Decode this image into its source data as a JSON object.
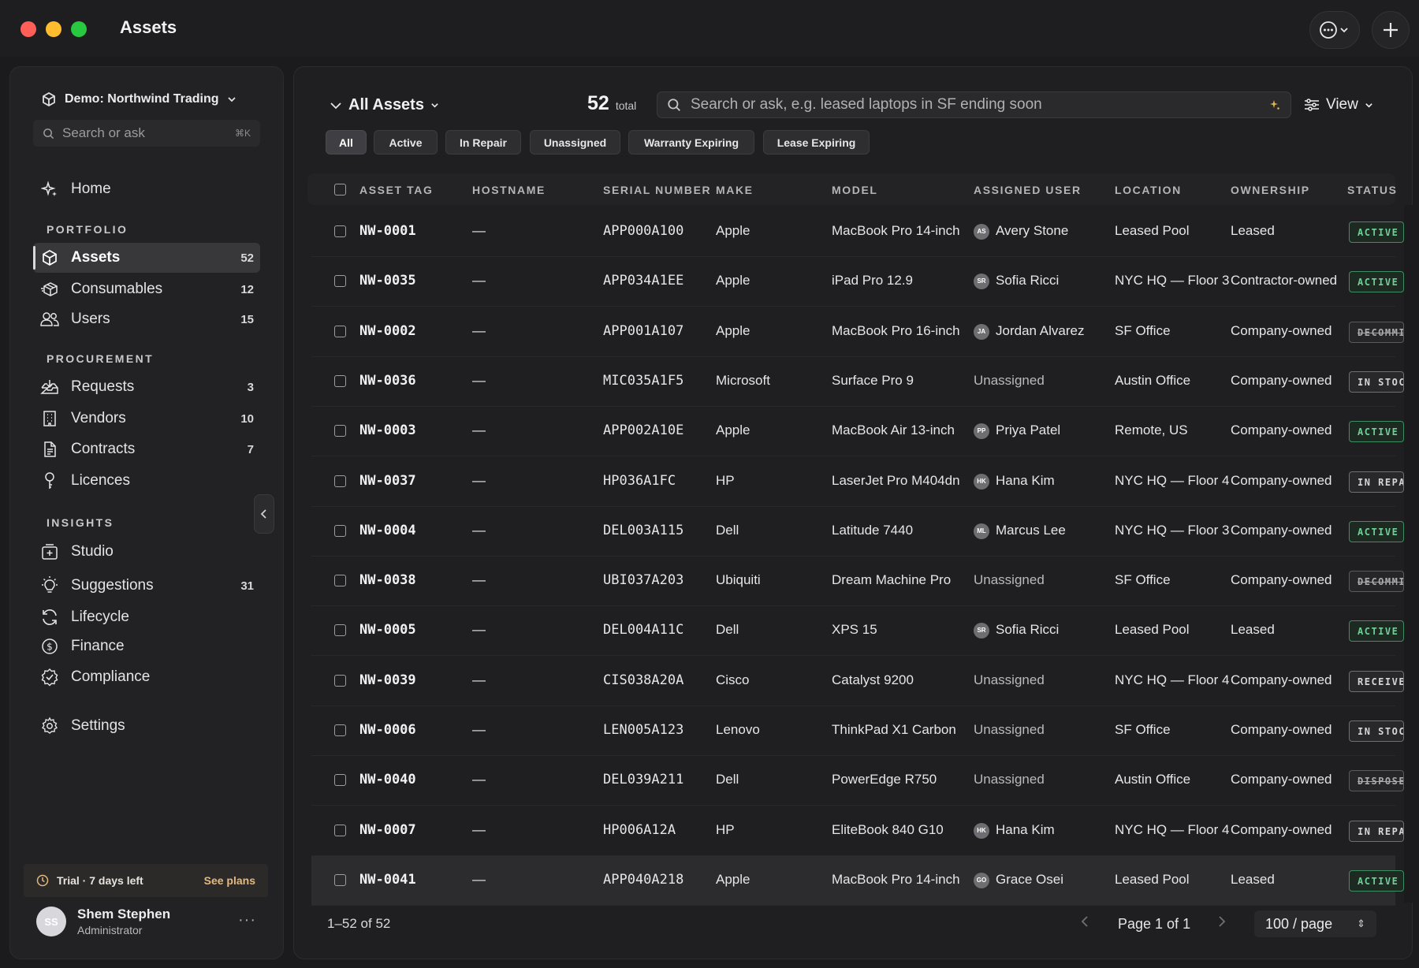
{
  "window": {
    "title": "Assets"
  },
  "sidebar": {
    "org_name": "Demo: Northwind Trading",
    "search_placeholder": "Search or ask",
    "search_shortcut": "⌘K",
    "home_label": "Home",
    "sections": {
      "portfolio": "PORTFOLIO",
      "procurement": "PROCUREMENT",
      "insights": "INSIGHTS"
    },
    "items": {
      "assets": {
        "label": "Assets",
        "count": "52"
      },
      "consumables": {
        "label": "Consumables",
        "count": "12"
      },
      "users": {
        "label": "Users",
        "count": "15"
      },
      "requests": {
        "label": "Requests",
        "count": "3"
      },
      "vendors": {
        "label": "Vendors",
        "count": "10"
      },
      "contracts": {
        "label": "Contracts",
        "count": "7"
      },
      "licences": {
        "label": "Licences"
      },
      "studio": {
        "label": "Studio"
      },
      "suggestions": {
        "label": "Suggestions",
        "count": "31"
      },
      "lifecycle": {
        "label": "Lifecycle"
      },
      "finance": {
        "label": "Finance"
      },
      "compliance": {
        "label": "Compliance"
      },
      "settings": {
        "label": "Settings"
      }
    },
    "trial": {
      "text": "Trial · 7 days left",
      "link": "See plans"
    },
    "user": {
      "initials": "SS",
      "name": "Shem Stephen",
      "role": "Administrator"
    }
  },
  "main": {
    "view_title": "All Assets",
    "total_count": "52",
    "total_label": "total",
    "search_placeholder": "Search or ask, e.g. leased laptops in SF ending soon",
    "view_label": "View",
    "filters": [
      "All",
      "Active",
      "In Repair",
      "Unassigned",
      "Warranty Expiring",
      "Lease Expiring"
    ],
    "columns": [
      "ASSET TAG",
      "HOSTNAME",
      "SERIAL NUMBER",
      "MAKE",
      "MODEL",
      "ASSIGNED USER",
      "LOCATION",
      "OWNERSHIP",
      "STATUS"
    ],
    "rows": [
      {
        "tag": "NW-0001",
        "host": "—",
        "serial": "APP000A100",
        "make": "Apple",
        "model": "MacBook Pro 14-inch",
        "user_initials": "AS",
        "user": "Avery Stone",
        "location": "Leased Pool",
        "ownership": "Leased",
        "status": "ACTIVE"
      },
      {
        "tag": "NW-0035",
        "host": "—",
        "serial": "APP034A1EE",
        "make": "Apple",
        "model": "iPad Pro 12.9",
        "user_initials": "SR",
        "user": "Sofia Ricci",
        "location": "NYC HQ — Floor 3",
        "ownership": "Contractor-owned",
        "status": "ACTIVE"
      },
      {
        "tag": "NW-0002",
        "host": "—",
        "serial": "APP001A107",
        "make": "Apple",
        "model": "MacBook Pro 16-inch",
        "user_initials": "JA",
        "user": "Jordan Alvarez",
        "location": "SF Office",
        "ownership": "Company-owned",
        "status": "DECOMMISSIONED"
      },
      {
        "tag": "NW-0036",
        "host": "—",
        "serial": "MIC035A1F5",
        "make": "Microsoft",
        "model": "Surface Pro 9",
        "user_initials": "",
        "user": "Unassigned",
        "location": "Austin Office",
        "ownership": "Company-owned",
        "status": "IN STOCK"
      },
      {
        "tag": "NW-0003",
        "host": "—",
        "serial": "APP002A10E",
        "make": "Apple",
        "model": "MacBook Air 13-inch",
        "user_initials": "PP",
        "user": "Priya Patel",
        "location": "Remote, US",
        "ownership": "Company-owned",
        "status": "ACTIVE"
      },
      {
        "tag": "NW-0037",
        "host": "—",
        "serial": "HP036A1FC",
        "make": "HP",
        "model": "LaserJet Pro M404dn",
        "user_initials": "HK",
        "user": "Hana Kim",
        "location": "NYC HQ — Floor 4",
        "ownership": "Company-owned",
        "status": "IN REPAIR"
      },
      {
        "tag": "NW-0004",
        "host": "—",
        "serial": "DEL003A115",
        "make": "Dell",
        "model": "Latitude 7440",
        "user_initials": "ML",
        "user": "Marcus Lee",
        "location": "NYC HQ — Floor 3",
        "ownership": "Company-owned",
        "status": "ACTIVE"
      },
      {
        "tag": "NW-0038",
        "host": "—",
        "serial": "UBI037A203",
        "make": "Ubiquiti",
        "model": "Dream Machine Pro",
        "user_initials": "",
        "user": "Unassigned",
        "location": "SF Office",
        "ownership": "Company-owned",
        "status": "DECOMMISSIONED"
      },
      {
        "tag": "NW-0005",
        "host": "—",
        "serial": "DEL004A11C",
        "make": "Dell",
        "model": "XPS 15",
        "user_initials": "SR",
        "user": "Sofia Ricci",
        "location": "Leased Pool",
        "ownership": "Leased",
        "status": "ACTIVE"
      },
      {
        "tag": "NW-0039",
        "host": "—",
        "serial": "CIS038A20A",
        "make": "Cisco",
        "model": "Catalyst 9200",
        "user_initials": "",
        "user": "Unassigned",
        "location": "NYC HQ — Floor 4",
        "ownership": "Company-owned",
        "status": "RECEIVED"
      },
      {
        "tag": "NW-0006",
        "host": "—",
        "serial": "LEN005A123",
        "make": "Lenovo",
        "model": "ThinkPad X1 Carbon",
        "user_initials": "",
        "user": "Unassigned",
        "location": "SF Office",
        "ownership": "Company-owned",
        "status": "IN STOCK"
      },
      {
        "tag": "NW-0040",
        "host": "—",
        "serial": "DEL039A211",
        "make": "Dell",
        "model": "PowerEdge R750",
        "user_initials": "",
        "user": "Unassigned",
        "location": "Austin Office",
        "ownership": "Company-owned",
        "status": "DISPOSED"
      },
      {
        "tag": "NW-0007",
        "host": "—",
        "serial": "HP006A12A",
        "make": "HP",
        "model": "EliteBook 840 G10",
        "user_initials": "HK",
        "user": "Hana Kim",
        "location": "NYC HQ — Floor 4",
        "ownership": "Company-owned",
        "status": "IN REPAIR"
      },
      {
        "tag": "NW-0041",
        "host": "—",
        "serial": "APP040A218",
        "make": "Apple",
        "model": "MacBook Pro 14-inch",
        "user_initials": "GO",
        "user": "Grace Osei",
        "location": "Leased Pool",
        "ownership": "Leased",
        "status": "ACTIVE"
      }
    ],
    "footer": {
      "range": "1–52 of 52",
      "page": "Page 1 of 1",
      "per_page": "100 / page"
    }
  },
  "colors": {
    "accent_active": "#6fcf97",
    "trial_link": "#e2b880",
    "spark": "#e0b64a"
  }
}
